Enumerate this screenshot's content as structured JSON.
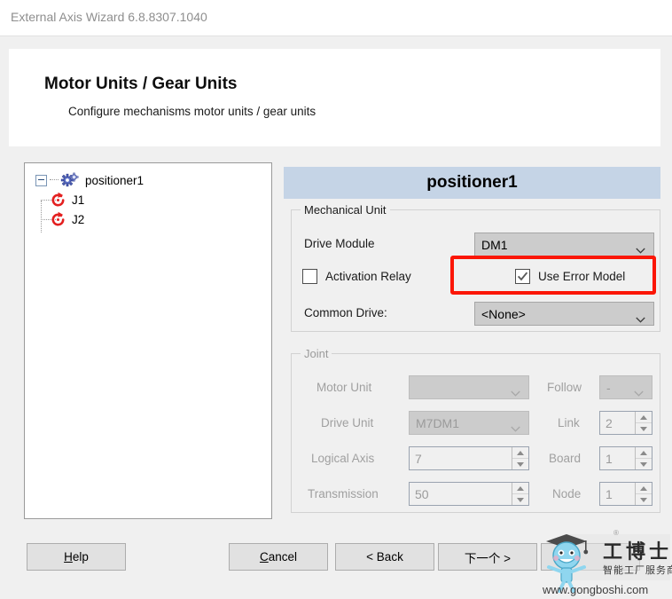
{
  "window": {
    "title": "External Axis Wizard 6.8.8307.1040"
  },
  "header": {
    "title": "Motor Units / Gear Units",
    "subtitle": "Configure mechanisms motor units / gear units"
  },
  "tree": {
    "root": {
      "label": "positioner1",
      "icon": "gear-icon",
      "expanded": true
    },
    "children": [
      {
        "label": "J1",
        "icon": "rotation-axis-icon"
      },
      {
        "label": "J2",
        "icon": "rotation-axis-icon"
      }
    ]
  },
  "panel": {
    "unit_title": "positioner1",
    "mechanical_unit": {
      "legend": "Mechanical Unit",
      "drive_module_label": "Drive Module",
      "drive_module_value": "DM1",
      "activation_relay_label": "Activation Relay",
      "activation_relay_checked": false,
      "use_error_model_label": "Use Error Model",
      "use_error_model_checked": true,
      "common_drive_label": "Common Drive:",
      "common_drive_value": "<None>"
    },
    "joint": {
      "legend": "Joint",
      "enabled": false,
      "motor_unit_label": "Motor Unit",
      "motor_unit_value": "",
      "drive_unit_label": "Drive Unit",
      "drive_unit_value": "M7DM1",
      "logical_axis_label": "Logical Axis",
      "logical_axis_value": "7",
      "transmission_label": "Transmission",
      "transmission_value": "50",
      "follow_label": "Follow",
      "follow_value": "-",
      "link_label": "Link",
      "link_value": "2",
      "board_label": "Board",
      "board_value": "1",
      "node_label": "Node",
      "node_value": "1"
    }
  },
  "highlight": {
    "color": "#fb1606",
    "target": "use-error-model-checkbox"
  },
  "buttons": {
    "help": {
      "pre": "",
      "accel": "H",
      "post": "elp"
    },
    "cancel": {
      "pre": "",
      "accel": "C",
      "post": "ancel"
    },
    "back": "< Back",
    "next": "下一个 >",
    "finish": ""
  },
  "watermark": {
    "brand_cn": "工博士",
    "tagline_cn": "智能工厂服务商",
    "url": "www.gongboshi.com",
    "registered_mark": "®"
  }
}
